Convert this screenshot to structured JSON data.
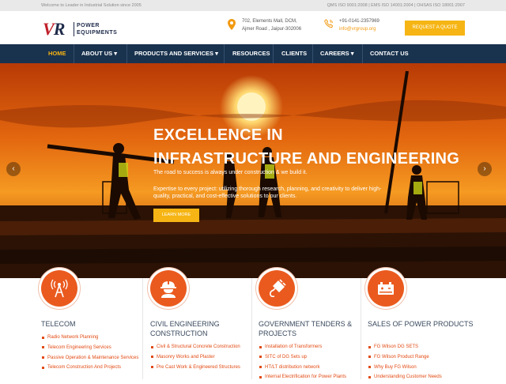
{
  "topbar": {
    "welcome": "Welcome to Leader in Industrial Solution since 2005",
    "certs": "QMS ISO 9001:2008 | EMS ISO 14001:2004 | OHSAS ISO 18001:2007"
  },
  "header": {
    "logo": {
      "mark_v": "V",
      "mark_r": "R",
      "line1": "POWER",
      "line2": "EQUIPMENTS"
    },
    "address_line1": "702, Elements Mall, DCM,",
    "address_line2": "Ajmer Road , Jaipur-302006",
    "phone": "+91-0141-2357969",
    "email": "info@vrgroup.org",
    "quote_label": "REQUEST A QUOTE"
  },
  "nav": {
    "items": [
      {
        "label": "HOME"
      },
      {
        "label": "ABOUT US ▾"
      },
      {
        "label": "PRODUCTS AND SERVICES ▾"
      },
      {
        "label": "RESOURCES"
      },
      {
        "label": "CLIENTS"
      },
      {
        "label": "CAREERS ▾"
      },
      {
        "label": "CONTACT US"
      }
    ]
  },
  "hero": {
    "title_line1": "EXCELLENCE IN",
    "title_line2": "INFRASTRUCTURE AND ENGINEERING",
    "subtitle": "The road to success is always under construction & we build it.",
    "paragraph": "Expertise to every project: utilizing thorough research, planning, and creativity to deliver high-quality, practical, and cost-effective solutions to our clients.",
    "button": "LEARN MORE",
    "prev": "‹",
    "next": "›"
  },
  "colors": {
    "accent": "#f6b514",
    "nav": "#19324e",
    "orange": "#ea5a1e",
    "link": "#e24a12"
  },
  "services": [
    {
      "icon": "radio-tower-icon",
      "title": "TELECOM",
      "items": [
        "Radio Network Planning",
        "Telecom Engineering Services",
        "Passive Operation & Maintenance Services",
        "Telecom Construction And Projects"
      ]
    },
    {
      "icon": "engineer-helmet-icon",
      "title": "CIVIL ENGINEERING CONSTRUCTION",
      "items": [
        "Civil & Structural Concrete Construction",
        "Masonry Works and Plaster",
        "Pre Cast Work & Engineered Structures"
      ]
    },
    {
      "icon": "electric-plug-icon",
      "title": "GOVERNMENT TENDERS & PROJECTS",
      "items": [
        "Installation of Transformers",
        "SITC of DG Sets up",
        "HT/LT distribution network",
        "Internal Electrification for Power Plants"
      ]
    },
    {
      "icon": "generator-icon",
      "title": "SALES OF POWER PRODUCTS",
      "items": [
        "FG Wilson DG SETS",
        "FG Wilson Product Range",
        "Why Buy FG Wilson",
        "Understanding Customer Needs"
      ]
    }
  ]
}
